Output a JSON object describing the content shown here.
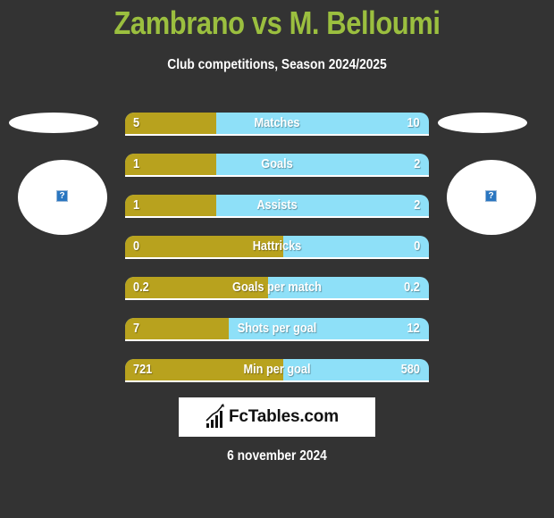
{
  "header": {
    "title": "Zambrano vs M. Belloumi",
    "subtitle": "Club competitions, Season 2024/2025"
  },
  "players": {
    "left": {
      "name": "Zambrano",
      "avatar_icon": "missing-image-icon"
    },
    "right": {
      "name": "M. Belloumi",
      "avatar_icon": "missing-image-icon"
    }
  },
  "colors": {
    "title": "#9bbf3f",
    "left_bar": "#b8a21e",
    "right_bar": "#8ee0f8",
    "background": "#333333"
  },
  "stats": [
    {
      "label": "Matches",
      "left": "5",
      "right": "10",
      "left_share": 0.3
    },
    {
      "label": "Goals",
      "left": "1",
      "right": "2",
      "left_share": 0.3
    },
    {
      "label": "Assists",
      "left": "1",
      "right": "2",
      "left_share": 0.3
    },
    {
      "label": "Hattricks",
      "left": "0",
      "right": "0",
      "left_share": 0.52
    },
    {
      "label": "Goals per match",
      "left": "0.2",
      "right": "0.2",
      "left_share": 0.47
    },
    {
      "label": "Shots per goal",
      "left": "7",
      "right": "12",
      "left_share": 0.34
    },
    {
      "label": "Min per goal",
      "left": "721",
      "right": "580",
      "left_share": 0.52
    }
  ],
  "logo": {
    "text": "FcTables.com",
    "icon": "bar-chart-trend-icon"
  },
  "date": "6 november 2024"
}
